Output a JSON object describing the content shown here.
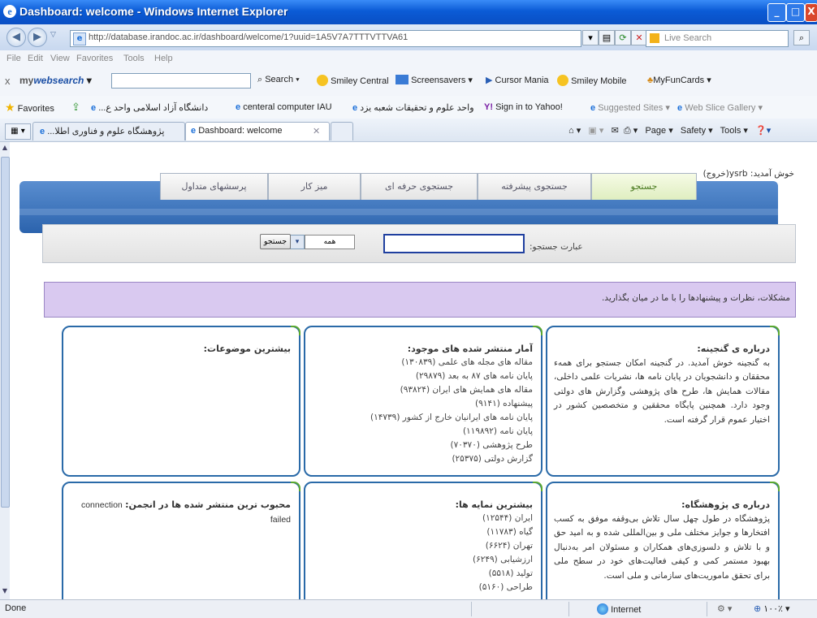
{
  "window": {
    "title": "Dashboard: welcome - Windows Internet Explorer",
    "address": "http://database.irandoc.ac.ir/dashboard/welcome/1?uuid=1A5V7A7TTTVTTVA61",
    "search_placeholder": "Live Search"
  },
  "menubar": [
    "File",
    "Edit",
    "View",
    "Favorites",
    "Tools",
    "Help"
  ],
  "toolbar": {
    "brand_prefix": "my",
    "brand_main": "websearch",
    "search_label": "Search",
    "smiley_central": "Smiley Central",
    "screensavers": "Screensavers",
    "cursor_mania": "Cursor Mania",
    "smiley_mobile": "Smiley Mobile",
    "myfuncards": "MyFunCards"
  },
  "favorites": {
    "label": "Favorites",
    "links": [
      "...دانشگاه آزاد اسلامی واحد ع",
      "centeral computer IAU",
      "واحد علوم و تحقیقات شعبه یزد",
      "Sign in to Yahoo!",
      "Suggested Sites",
      "Web Slice Gallery"
    ]
  },
  "tabs": {
    "tab1": "...پژوهشگاه علوم و فناوری اطلا",
    "tab2": "Dashboard: welcome"
  },
  "commandbar": {
    "page": "Page",
    "safety": "Safety",
    "tools": "Tools"
  },
  "site": {
    "greeting": "خوش آمدید: ysrb(خروج)",
    "nav_tabs": [
      "جستجو",
      "جستجوی پیشرفته",
      "جستجوی حرفه ای",
      "میز کار",
      "پرسشهای متداول"
    ],
    "search_label": "عبارت جستجو:",
    "search_value": "",
    "scope_value": "همه",
    "search_button": "جستجو",
    "notice": "مشکلات، نظرات و پیشنهادها را با ما در میان بگذارید.",
    "about_title": "درباره ی گنجینه:",
    "about_text": "به گنجینه خوش آمدید. در گنجینه امکان جستجو برای همه‌ء محققان و دانشجویان در پایان نامه ها، نشریات علمی داخلی، مقالات همایش ها، طرح های پژوهشی وگزارش های دولتی وجود دارد. همچنین پایگاه محققین و متخصصین کشور در اختیار عموم قرار گرفته است.",
    "stats_title": "آمار منتشر شده های موجود:",
    "stats": [
      "مقاله های مجله های علمی (۱۳۰۸۳۹)",
      "پایان نامه های ۸۷ به بعد (۲۹۸۷۹)",
      "مقاله های همایش های ایران (۹۳۸۲۴)",
      "پیشنهاده (۹۱۴۱)",
      "پایان نامه های ایرانیان خارج از کشور (۱۴۷۳۹)",
      "پایان نامه (۱۱۹۸۹۲)",
      "طرح پژوهشی (۷۰۳۷۰)",
      "گزارش دولتی (۲۵۳۷۵)"
    ],
    "topics_title": "بیشترین موضوعات:",
    "research_title": "درباره ی پژوهشگاه:",
    "research_text": "پژوهشگاه در طول چهل سال تلاش بی‌وقفه موفق به کسب افتخارها و جوایز مختلف ملی و بین‌المللی شده و به امید حق و با تلاش و دلسوزی‌های همکاران و مسئولان امر به‌دنبال بهبود مستمر کمی و کیفی فعالیت‌های خود در سطح ملی برای تحقق ماموریت‌های سازمانی و ملی است.",
    "index_title": "بیشترین نمایه ها:",
    "index_items": [
      "ایران (۱۲۵۴۴)",
      "گیاه (۱۱۷۸۳)",
      "تهران (۶۶۲۴)",
      "ارزشیابی (۶۲۴۹)",
      "تولید (۵۵۱۸)",
      "طراحی (۵۱۶۰)"
    ],
    "popular_title": "محبوب ترین منتشر شده ها در انجمن:",
    "popular_error": "connection failed"
  },
  "status": {
    "left": "Done",
    "zone": "Internet",
    "zoom": "۱۰۰٪"
  },
  "colors": {
    "titlebar": "#0b5bd6",
    "site_blue": "#2b63ad",
    "card_border": "#2a6aa8",
    "notice_bg": "#d9c9f0",
    "accent_green": "#5aa830"
  }
}
